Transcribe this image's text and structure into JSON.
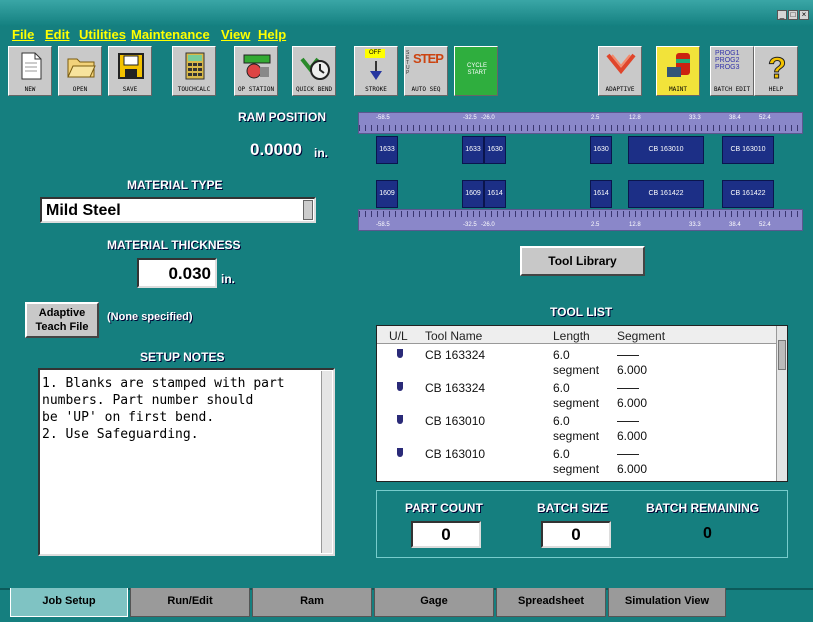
{
  "window": {
    "controls": [
      "_",
      "□",
      "×"
    ]
  },
  "menu": [
    "File",
    "Edit",
    "Utilities",
    "Maintenance",
    "View",
    "Help"
  ],
  "toolbar": [
    {
      "label": "NEW",
      "icon": "new-file-icon"
    },
    {
      "label": "OPEN",
      "icon": "open-folder-icon"
    },
    {
      "label": "SAVE",
      "icon": "save-disk-icon"
    },
    {
      "label": "TOUCHCALC",
      "icon": "calculator-icon"
    },
    {
      "label": "OP STATION",
      "icon": "op-station-icon"
    },
    {
      "label": "QUICK BEND",
      "icon": "quick-bend-icon"
    },
    {
      "label": "STROKE",
      "icon": "stroke-icon"
    },
    {
      "label": "AUTO SEQ",
      "icon": "auto-seq-icon"
    },
    {
      "label": "CYCLE START",
      "icon": "cycle-start-icon"
    },
    {
      "label": "ADAPTIVE",
      "icon": "adaptive-icon"
    },
    {
      "label": "MAINT",
      "icon": "maint-icon"
    },
    {
      "label": "BATCH EDIT",
      "icon": "batch-edit-icon"
    },
    {
      "label": "HELP",
      "icon": "help-icon"
    }
  ],
  "toolbar_text": {
    "stroke_off": "OFF",
    "setup": "SETUP",
    "step": "STEP",
    "prog": [
      "PROG1",
      "PROG2",
      "PROG3"
    ]
  },
  "ram": {
    "label": "RAM POSITION",
    "value": "0.0000",
    "unit": "in."
  },
  "material": {
    "type_label": "MATERIAL TYPE",
    "type_value": "Mild Steel",
    "thickness_label": "MATERIAL THICKNESS",
    "thickness_value": "0.030",
    "unit": "in."
  },
  "adaptive": {
    "button": "Adaptive Teach File",
    "status": "(None specified)"
  },
  "setup_notes": {
    "label": "SETUP NOTES",
    "lines": [
      "1. Blanks are stamped with part",
      "numbers. Part number should",
      "be 'UP' on first bend.",
      "2. Use Safeguarding."
    ]
  },
  "scale_top": [
    "-58.5",
    "-32.5",
    "-26.0",
    "2.5",
    "12.8",
    "33.3",
    "38.4",
    "52.4"
  ],
  "scale_bottom": [
    "-58.5",
    "-32.5",
    "-26.0",
    "2.5",
    "12.8",
    "33.3",
    "38.4",
    "52.4"
  ],
  "punch_row": [
    "1633",
    "1633",
    "1630",
    "1630",
    "CB 163010",
    "CB 163010"
  ],
  "die_row": [
    "1609",
    "1609",
    "1614",
    "1614",
    "CB 161422",
    "CB 161422"
  ],
  "tool_library_button": "Tool Library",
  "tool_list": {
    "label": "TOOL LIST",
    "headers": [
      "U/L",
      "Tool Name",
      "Length",
      "Segment"
    ],
    "rows": [
      {
        "name": "CB 163324",
        "length": "6.0",
        "seg_label": "segment",
        "seg_value": "6.000"
      },
      {
        "name": "CB 163324",
        "length": "6.0",
        "seg_label": "segment",
        "seg_value": "6.000"
      },
      {
        "name": "CB 163010",
        "length": "6.0",
        "seg_label": "segment",
        "seg_value": "6.000"
      },
      {
        "name": "CB 163010",
        "length": "6.0",
        "seg_label": "segment",
        "seg_value": "6.000"
      }
    ]
  },
  "counts": {
    "part_count_label": "PART COUNT",
    "part_count": "0",
    "batch_size_label": "BATCH SIZE",
    "batch_size": "0",
    "batch_remaining_label": "BATCH REMAINING",
    "batch_remaining": "0"
  },
  "tabs": [
    "Job Setup",
    "Run/Edit",
    "Ram",
    "Gage",
    "Spreadsheet",
    "Simulation View"
  ]
}
